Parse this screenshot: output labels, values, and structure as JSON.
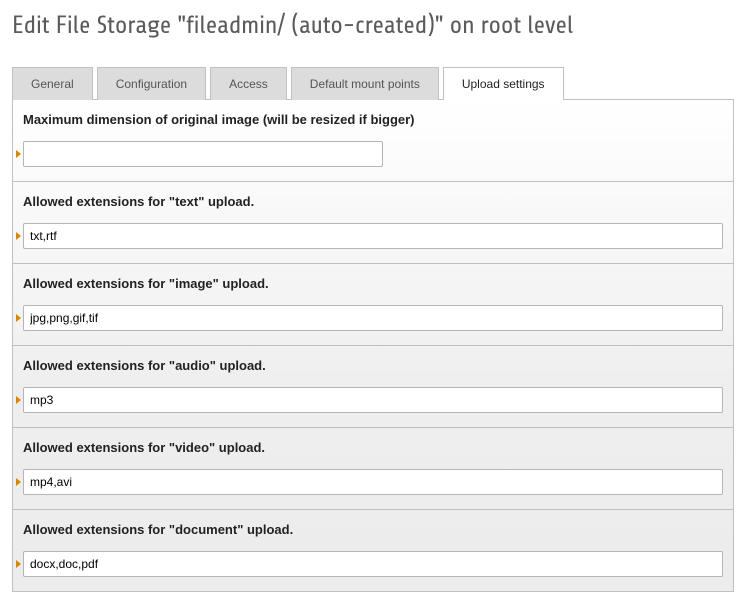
{
  "page_title": "Edit File Storage \"fileadmin/ (auto-created)\" on root level",
  "tabs": {
    "general": "General",
    "configuration": "Configuration",
    "access": "Access",
    "default_mount_points": "Default mount points",
    "upload_settings": "Upload settings"
  },
  "fields": {
    "max_dimension": {
      "label": "Maximum dimension of original image (will be resized if bigger)",
      "value": ""
    },
    "ext_text": {
      "label": "Allowed extensions for \"text\" upload.",
      "value": "txt,rtf"
    },
    "ext_image": {
      "label": "Allowed extensions for \"image\" upload.",
      "value": "jpg,png,gif,tif"
    },
    "ext_audio": {
      "label": "Allowed extensions for \"audio\" upload.",
      "value": "mp3"
    },
    "ext_video": {
      "label": "Allowed extensions for \"video\" upload.",
      "value": "mp4,avi"
    },
    "ext_document": {
      "label": "Allowed extensions for \"document\" upload.",
      "value": "docx,doc,pdf"
    }
  }
}
